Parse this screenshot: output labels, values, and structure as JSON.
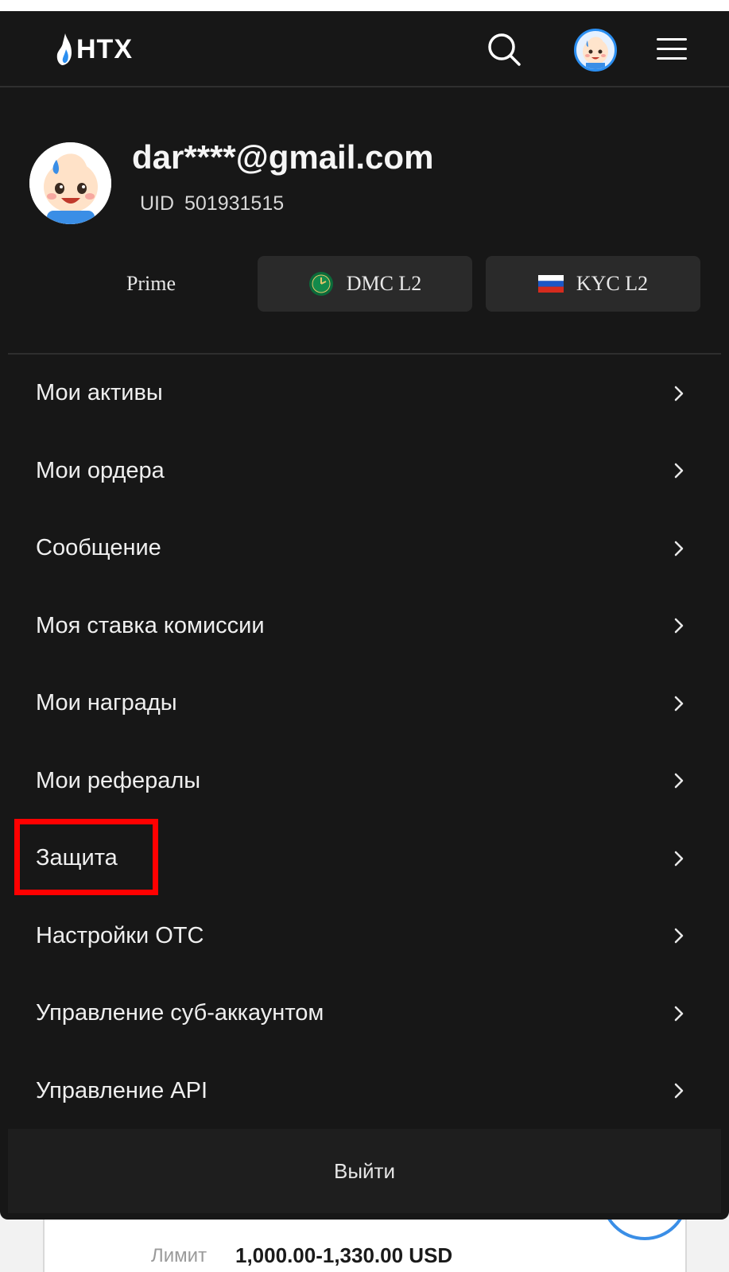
{
  "header": {
    "logo_text": "HTX",
    "search_icon": "search-icon",
    "menu_icon": "hamburger-menu-icon"
  },
  "profile": {
    "email": "dar****@gmail.com",
    "uid_label": "UID",
    "uid_value": "501931515",
    "uid_text": "UID  501931515"
  },
  "badges": {
    "prime": "Prime",
    "dmc": "DMC L2",
    "kyc": "KYC L2"
  },
  "menu": {
    "items": [
      {
        "label": "Мои активы"
      },
      {
        "label": "Мои ордера"
      },
      {
        "label": "Сообщение"
      },
      {
        "label": "Моя ставка комиссии"
      },
      {
        "label": "Мои награды"
      },
      {
        "label": "Мои рефералы"
      },
      {
        "label": "Защита"
      },
      {
        "label": "Настройки OTC"
      },
      {
        "label": "Управление суб-аккаунтом"
      },
      {
        "label": "Управление API"
      }
    ]
  },
  "logout": {
    "label": "Выйти"
  },
  "background_page": {
    "limit_label": "Лимит",
    "limit_value": "1,000.00-1,330.00 USD"
  },
  "colors": {
    "panel_bg": "#171717",
    "accent_blue": "#2b8ef0",
    "highlight_red": "#ff0000"
  }
}
